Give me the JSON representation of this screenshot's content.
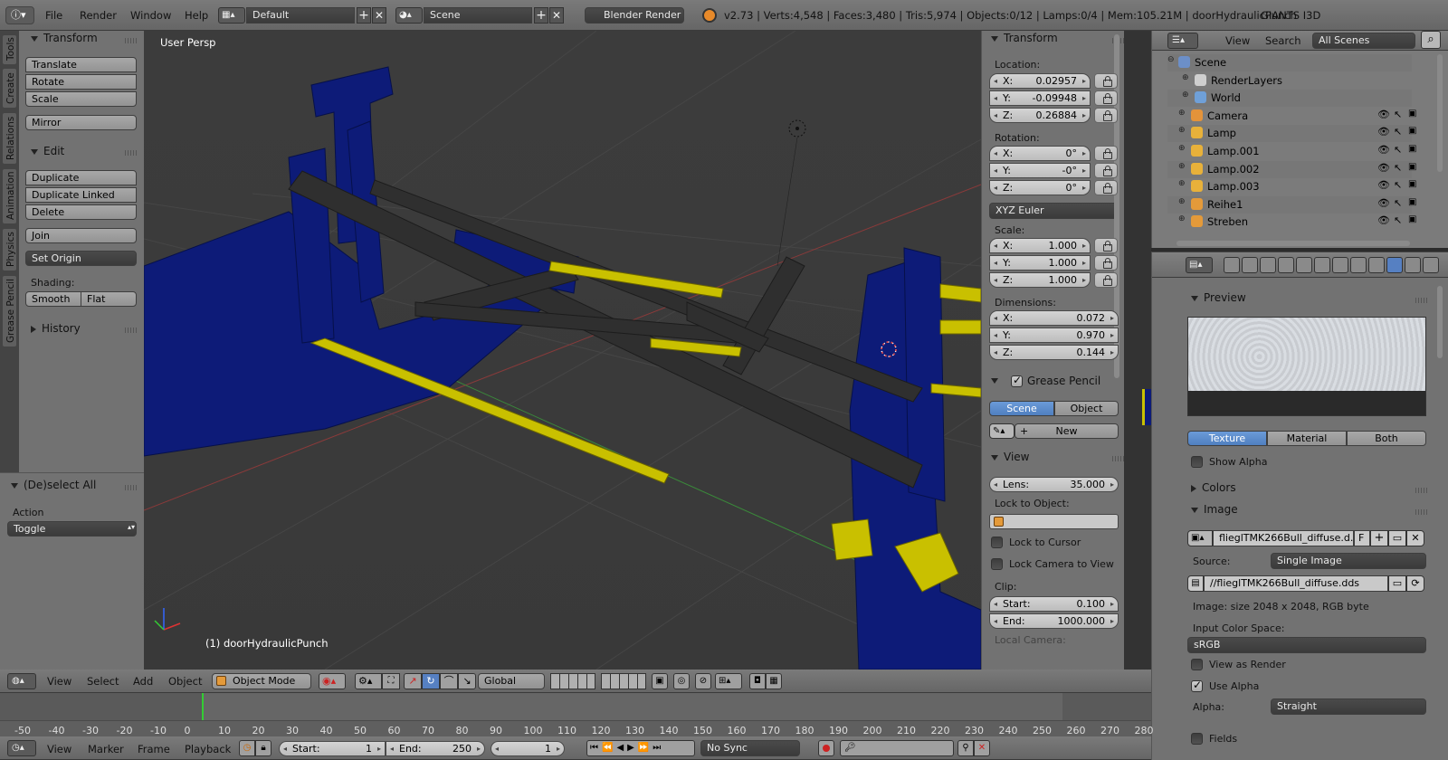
{
  "topbar": {
    "menus": [
      "File",
      "Render",
      "Window",
      "Help"
    ],
    "screen_layout": "Default",
    "scene": "Scene",
    "engine": "Blender Render",
    "stats": "v2.73 | Verts:4,548 | Faces:3,480 | Tris:5,974 | Objects:0/12 | Lamps:0/4 | Mem:105.21M | doorHydraulicPunch",
    "brand": "GIANTS I3D"
  },
  "tool_tabs": [
    "Tools",
    "Create",
    "Relations",
    "Animation",
    "Physics",
    "Grease Pencil"
  ],
  "tools": {
    "transform_header": "Transform",
    "translate": "Translate",
    "rotate": "Rotate",
    "scale": "Scale",
    "mirror": "Mirror",
    "edit_header": "Edit",
    "duplicate": "Duplicate",
    "duplicate_linked": "Duplicate Linked",
    "delete": "Delete",
    "join": "Join",
    "set_origin": "Set Origin",
    "shading_label": "Shading:",
    "smooth": "Smooth",
    "flat": "Flat",
    "history_header": "History",
    "deselect_header": "(De)select All",
    "action_label": "Action",
    "action_value": "Toggle"
  },
  "viewport": {
    "view_label": "User Persp",
    "object_label": "(1) doorHydraulicPunch"
  },
  "vp_header": {
    "view": "View",
    "select": "Select",
    "add": "Add",
    "object": "Object",
    "mode": "Object Mode",
    "orientation": "Global"
  },
  "props": {
    "transform_header": "Transform",
    "location_label": "Location:",
    "location": [
      {
        "axis": "X:",
        "value": "0.02957"
      },
      {
        "axis": "Y:",
        "value": "-0.09948"
      },
      {
        "axis": "Z:",
        "value": "0.26884"
      }
    ],
    "rotation_label": "Rotation:",
    "rotation": [
      {
        "axis": "X:",
        "value": "0°"
      },
      {
        "axis": "Y:",
        "value": "-0°"
      },
      {
        "axis": "Z:",
        "value": "0°"
      }
    ],
    "rotation_mode": "XYZ Euler",
    "scale_label": "Scale:",
    "scale": [
      {
        "axis": "X:",
        "value": "1.000"
      },
      {
        "axis": "Y:",
        "value": "1.000"
      },
      {
        "axis": "Z:",
        "value": "1.000"
      }
    ],
    "dimensions_label": "Dimensions:",
    "dimensions": [
      {
        "axis": "X:",
        "value": "0.072"
      },
      {
        "axis": "Y:",
        "value": "0.970"
      },
      {
        "axis": "Z:",
        "value": "0.144"
      }
    ],
    "grease_header": "Grease Pencil",
    "gp_scene": "Scene",
    "gp_object": "Object",
    "gp_new": "New",
    "view_header": "View",
    "lens_label": "Lens:",
    "lens_value": "35.000",
    "lock_object_label": "Lock to Object:",
    "lock_cursor": "Lock to Cursor",
    "lock_camera": "Lock Camera to View",
    "clip_label": "Clip:",
    "clip_start_label": "Start:",
    "clip_start": "0.100",
    "clip_end_label": "End:",
    "clip_end": "1000.000",
    "local_camera": "Local Camera:"
  },
  "outliner": {
    "view": "View",
    "search": "Search",
    "filter": "All Scenes",
    "items": [
      {
        "name": "Scene"
      },
      {
        "name": "RenderLayers"
      },
      {
        "name": "World"
      },
      {
        "name": "Camera"
      },
      {
        "name": "Lamp"
      },
      {
        "name": "Lamp.001"
      },
      {
        "name": "Lamp.002"
      },
      {
        "name": "Lamp.003"
      },
      {
        "name": "Reihe1"
      },
      {
        "name": "Streben"
      }
    ]
  },
  "texture": {
    "preview_header": "Preview",
    "tab_texture": "Texture",
    "tab_material": "Material",
    "tab_both": "Both",
    "show_alpha": "Show Alpha",
    "colors_header": "Colors",
    "image_header": "Image",
    "image_name": "flieglTMK266Bull_diffuse.d...",
    "image_flag": "F",
    "source_label": "Source:",
    "source_value": "Single Image",
    "filepath": "//flieglTMK266Bull_diffuse.dds",
    "image_info": "Image: size 2048 x 2048, RGB byte",
    "color_space_label": "Input Color Space:",
    "color_space": "sRGB",
    "view_as_render": "View as Render",
    "use_alpha": "Use Alpha",
    "alpha_label": "Alpha:",
    "alpha_value": "Straight",
    "fields": "Fields"
  },
  "timeline": {
    "ticks": [
      "-50",
      "-40",
      "-30",
      "-20",
      "-10",
      "0",
      "10",
      "20",
      "30",
      "40",
      "50",
      "60",
      "70",
      "80",
      "90",
      "100",
      "110",
      "120",
      "130",
      "140",
      "150",
      "160",
      "170",
      "180",
      "190",
      "200",
      "210",
      "220",
      "230",
      "240",
      "250",
      "260",
      "270",
      "280"
    ],
    "view": "View",
    "marker": "Marker",
    "frame": "Frame",
    "playback": "Playback",
    "start_label": "Start:",
    "start": "1",
    "end_label": "End:",
    "end": "250",
    "current": "1",
    "sync": "No Sync"
  },
  "colors": {
    "accent": "#5680c2",
    "blue_mesh": "#0b1a6e",
    "yellow_mesh": "#c8c000",
    "dark_mesh": "#2e2e2e"
  }
}
